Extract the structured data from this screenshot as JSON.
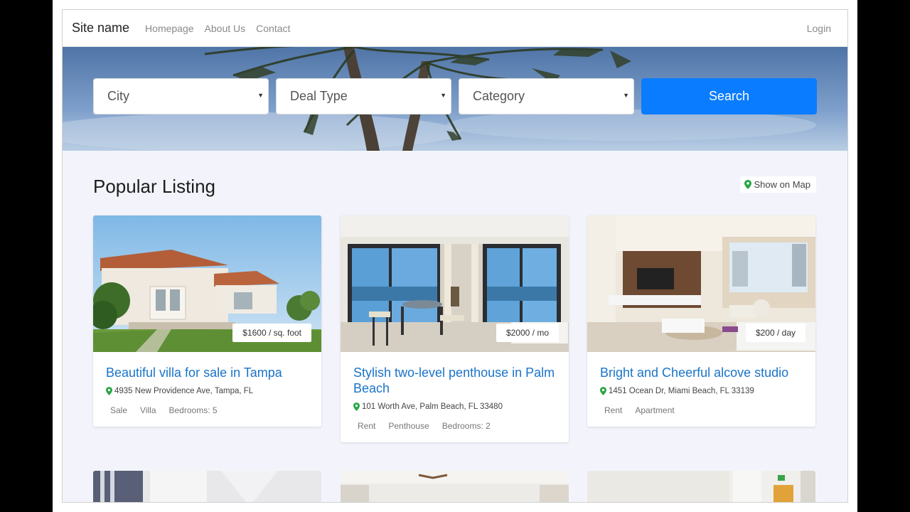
{
  "navbar": {
    "brand": "Site name",
    "links": [
      "Homepage",
      "About Us",
      "Contact"
    ],
    "login": "Login"
  },
  "search": {
    "city": "City",
    "deal_type": "Deal Type",
    "category": "Category",
    "button": "Search"
  },
  "section": {
    "title": "Popular Listing",
    "map_button": "Show on Map"
  },
  "listings": [
    {
      "title": "Beautiful villa for sale in Tampa",
      "address": "4935 New Providence Ave, Tampa, FL",
      "price": "$1600 / sq. foot",
      "tags": [
        "Sale",
        "Villa",
        "Bedrooms: 5"
      ]
    },
    {
      "title": "Stylish two-level penthouse in Palm Beach",
      "address": "101 Worth Ave, Palm Beach, FL 33480",
      "price": "$2000 / mo",
      "tags": [
        "Rent",
        "Penthouse",
        "Bedrooms: 2"
      ]
    },
    {
      "title": "Bright and Cheerful alcove studio",
      "address": "1451 Ocean Dr, Miami Beach, FL 33139",
      "price": "$200 / day",
      "tags": [
        "Rent",
        "Apartment"
      ]
    }
  ],
  "colors": {
    "accent": "#0a7cff",
    "title_link": "#1a74c9",
    "pin": "#28a745"
  }
}
